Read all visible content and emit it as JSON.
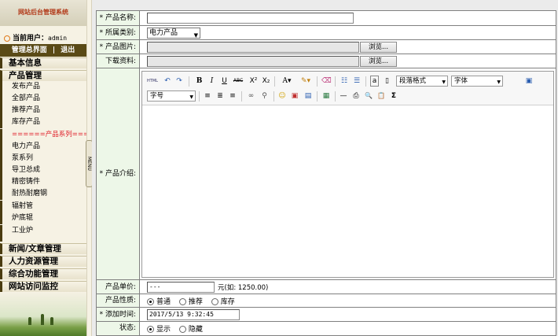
{
  "sidebar": {
    "title": "网站后台管理系统",
    "current_user_label": "当前用户：",
    "current_user": "admin",
    "links": {
      "home": "管理总界面",
      "separator": "|",
      "logout": "退出"
    },
    "sections": [
      "基本信息",
      "产品管理"
    ],
    "product_items": [
      "发布产品",
      "全部产品",
      "推荐产品",
      "库存产品",
      "======产品系列======",
      "电力产品",
      "泵系列",
      "导卫总成",
      "精密铸件",
      "耐热耐磨钢",
      "辐射管",
      "炉底辊",
      "工业炉"
    ],
    "bottom_sections": [
      "新闻/文章管理",
      "人力资源管理",
      "综合功能管理",
      "网站访问监控"
    ],
    "menu_tab": "MENU"
  },
  "form": {
    "product_name": {
      "label": "* 产品名称:",
      "value": ""
    },
    "category": {
      "label": "* 所属类别:",
      "value": "电力产品"
    },
    "image": {
      "label": "* 产品图片:",
      "value": "",
      "browse": "浏览..."
    },
    "download": {
      "label": "下载资料:",
      "value": "",
      "browse": "浏览..."
    },
    "intro": {
      "label": "* 产品介绍:"
    },
    "price": {
      "label": "产品单价:",
      "value": "---",
      "hint": "元(如: 1250.00)"
    },
    "nature": {
      "label": "产品性质:",
      "options": [
        "普通",
        "推荐",
        "库存"
      ],
      "selected": "普通"
    },
    "add_time": {
      "label": "* 添加时间:",
      "value": "2017/5/13 9:32:45"
    },
    "status": {
      "label": "状态:",
      "options": [
        "显示",
        "隐藏"
      ],
      "selected": "显示"
    }
  },
  "editor": {
    "toolbar_row1": [
      "HTML",
      "↶",
      "↷",
      "B",
      "I",
      "U",
      "ABC",
      "X²",
      "X₂",
      "A▾",
      "✎▾",
      "⌫",
      "☷",
      "☰",
      "a",
      "▯"
    ],
    "paragraph_format": "段落格式",
    "font_family": "字体",
    "font_size": "字号",
    "toolbar_row2": [
      "≡",
      "≣",
      "≡",
      "∞",
      "⚲",
      "☺",
      "▣",
      "▤",
      "▦",
      "—",
      "⎙",
      "🔍",
      "📋",
      "Σ"
    ],
    "content": ""
  }
}
